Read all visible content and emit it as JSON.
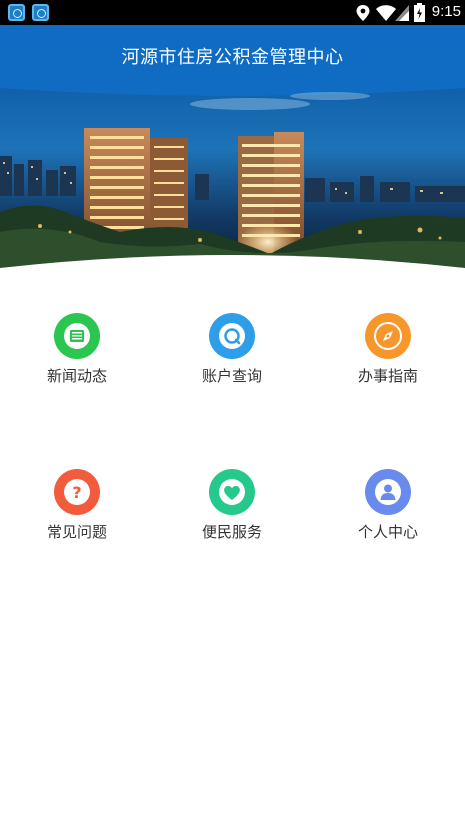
{
  "status_bar": {
    "time": "9:15",
    "icons": [
      "app-icon",
      "app-icon",
      "location-icon",
      "wifi-icon",
      "signal-icon",
      "battery-icon"
    ]
  },
  "header": {
    "title": "河源市住房公积金管理中心",
    "color": "#0f6cc2"
  },
  "banner": {
    "description_icon": "city-night-banner"
  },
  "menu": {
    "items": [
      {
        "label": "新闻动态",
        "icon": "news-icon",
        "color": "#2ac64f"
      },
      {
        "label": "账户查询",
        "icon": "search-icon",
        "color": "#2e9ee8"
      },
      {
        "label": "办事指南",
        "icon": "compass-icon",
        "color": "#f7962b"
      },
      {
        "label": "常见问题",
        "icon": "question-icon",
        "color": "#f25b3c"
      },
      {
        "label": "便民服务",
        "icon": "heart-icon",
        "color": "#25c98b"
      },
      {
        "label": "个人中心",
        "icon": "user-icon",
        "color": "#6a8bee"
      }
    ]
  }
}
